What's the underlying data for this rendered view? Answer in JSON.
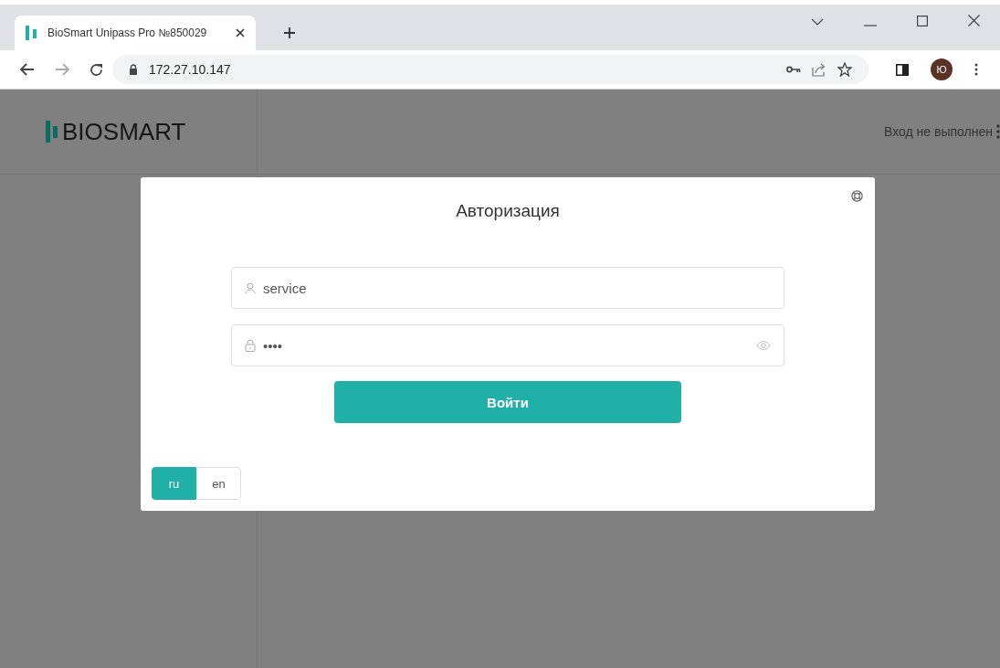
{
  "browser": {
    "tab": {
      "title": "BioSmart Unipass Pro №850029"
    },
    "address": "172.27.10.147",
    "profile_initial": "Ю"
  },
  "header": {
    "logo": "BIOSMART",
    "login_status": "Вход не выполнен"
  },
  "dialog": {
    "title": "Авторизация",
    "fields": [
      {
        "kind": "user",
        "value": "service"
      },
      {
        "kind": "password",
        "value": "••••"
      }
    ],
    "submit": "Войти",
    "languages": [
      {
        "label": "ru",
        "selected": true
      },
      {
        "label": "en",
        "selected": false
      }
    ]
  }
}
